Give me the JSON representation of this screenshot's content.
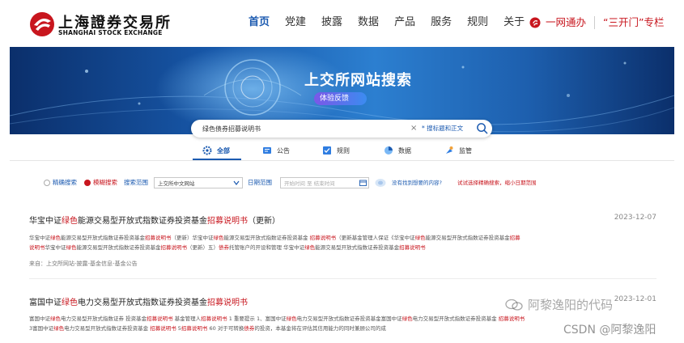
{
  "header": {
    "logo_cn": "上海證券交易所",
    "logo_en": "SHANGHAI STOCK EXCHANGE",
    "nav": [
      "首页",
      "党建",
      "披露",
      "数据",
      "产品",
      "服务",
      "规则",
      "关于"
    ],
    "yiwangtong": "一网通办",
    "santkaimen": "“三开门”专栏"
  },
  "banner": {
    "title": "上交所网站搜索",
    "feedback": "体验反馈"
  },
  "search": {
    "query": "绿色债券招募说明书",
    "scope": "* 搜标题和正文"
  },
  "tabs": [
    "全部",
    "公告",
    "规则",
    "数据",
    "监管"
  ],
  "filters": {
    "exact": "精确搜索",
    "fuzzy": "模糊搜索",
    "scope_label": "搜索范围",
    "scope_value": "上交所中文网站",
    "date_label": "日期范围",
    "date_placeholder": "开始时间 至 结束时间",
    "hint": "没有找到想要的内容?",
    "hint_red": "试试选择精确搜索，缩小日期范围"
  },
  "results": [
    {
      "title": [
        "华宝中证",
        "绿色",
        "能源交易型开放式指数证券投资基金",
        "招募说明书",
        "（更新）"
      ],
      "date": "2023-12-07",
      "line1": [
        "华宝中证",
        "绿色",
        "能源交易型开放式指数证券投资基金",
        "招募说明书",
        "（更新）华宝中证",
        "绿色",
        "能源交易型开放式指数证券投资基金 ",
        "招募说明书",
        "（更新基金管理人保证《华宝中证",
        "绿色",
        "能源交易型开放式指数证券投资基金",
        "招募"
      ],
      "line2": [
        "说明书",
        "华宝中证",
        "绿色",
        "能源交易型开放式指数证券投资基金",
        "招募说明书",
        "（更新）五）",
        "债券",
        "托管账户的开设和管理 华宝中证",
        "绿色",
        "能源交易型开放式指数证券投资基金",
        "招募说明书"
      ],
      "source": "来自：上交所网站-披露-基金信息-基金公告"
    },
    {
      "title": [
        "富国中证",
        "绿色",
        "电力交易型开放式指数证券投资基金",
        "招募说明书"
      ],
      "date": "2023-12-01",
      "line1": [
        "富国中证",
        "绿色",
        "电力交易型开放式指数证券 投资基金",
        "招募说明书",
        " 基金管理人",
        "招募说明书",
        " 1 重要提示 1、富国中证",
        "绿色",
        "电力交易型开放式指数证券投资基金富国中证",
        "绿色",
        "电力交易型开放式指数证券投资基金 ",
        "招募说明书"
      ],
      "line2": [
        "3富国中证",
        "绿色",
        "电力交易型开放式指数证券投资基金 ",
        "招募说明书",
        " 5",
        "招募说明书",
        " 60 对于可转换",
        "债券",
        "的投资，本基金将在评估其信用能力的同时兼顾公司的成"
      ]
    }
  ],
  "watermarks": {
    "wechat": "阿黎逸阳的代码",
    "csdn": "CSDN @阿黎逸阳"
  }
}
